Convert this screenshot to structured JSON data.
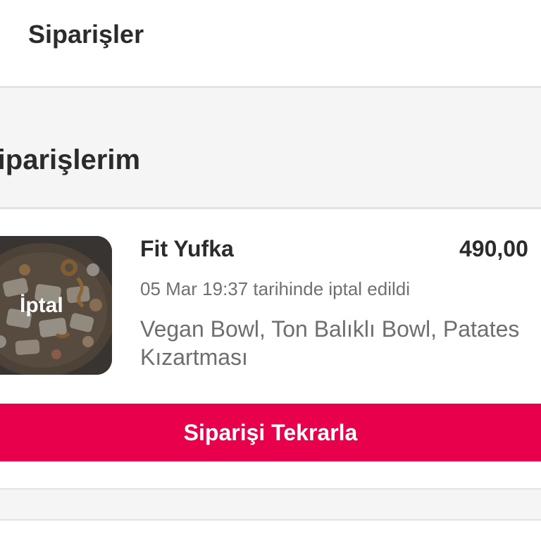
{
  "header": {
    "title": "Siparişler"
  },
  "section": {
    "title": "Siparişlerim"
  },
  "order": {
    "thumbnail_badge": "İptal",
    "restaurant": "Fit Yufka",
    "price": "490,00",
    "status": "05 Mar 19:37 tarihinde iptal edildi",
    "items": "Vegan Bowl, Ton Balıklı Bowl, Patates Kızartması",
    "reorder_label": "Siparişi Tekrarla"
  },
  "colors": {
    "accent": "#e8004c",
    "text_primary": "#2b2b2b",
    "text_secondary": "#707070",
    "band": "#f5f5f5"
  }
}
